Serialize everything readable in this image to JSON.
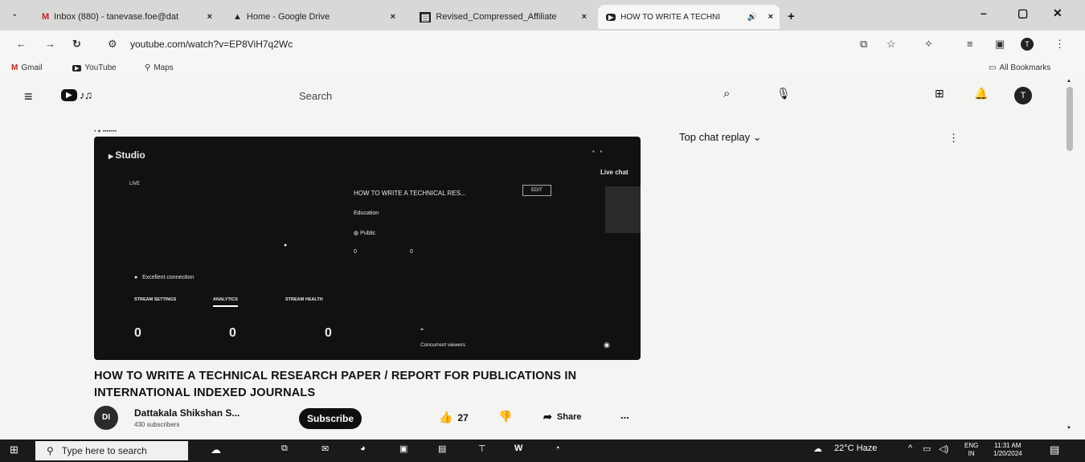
{
  "browser": {
    "tabs": [
      {
        "label": "Inbox (880) - tanevase.foe@dat",
        "icon": "gmail-icon"
      },
      {
        "label": "Home - Google Drive",
        "icon": "drive-icon"
      },
      {
        "label": "Revised_Compressed_Affiliate",
        "icon": "doc-icon"
      },
      {
        "label": "HOW TO WRITE A TECHNI",
        "icon": "youtube-icon"
      }
    ],
    "new_tab": "+",
    "url": "youtube.com/watch?v=EP8ViH7q2Wc",
    "bookmarks": [
      "Gmail",
      "YouTube",
      "Maps"
    ],
    "all_bookmarks": "All Bookmarks"
  },
  "youtube": {
    "search_placeholder": "Search",
    "chat_header": "Top chat replay"
  },
  "studio": {
    "brand": "Studio",
    "live_label": "LIVE",
    "live_chat": "Live chat",
    "video_title": "HOW TO WRITE A TECHNICAL RES...",
    "edit_btn": "EDIT",
    "category": "Education",
    "visibility": "Public",
    "stat_a": "0",
    "stat_b": "0",
    "connection": "Excellent connection",
    "tabs": [
      "STREAM SETTINGS",
      "ANALYTICS",
      "STREAM HEALTH"
    ],
    "counters": [
      "0",
      "0",
      "0",
      "-"
    ],
    "concurrent": "Concurrent viewers"
  },
  "video": {
    "title": "HOW TO WRITE A TECHNICAL RESEARCH PAPER / REPORT FOR PUBLICATIONS IN INTERNATIONAL INDEXED JOURNALS",
    "channel_name": "Dattakala Shikshan S...",
    "subscribers": "430 subscribers",
    "subscribe": "Subscribe",
    "likes": "27",
    "share": "Share",
    "more": "..."
  },
  "taskbar": {
    "search_placeholder": "Type here to search",
    "weather": "22°C Haze",
    "lang_top": "ENG",
    "lang_bottom": "IN",
    "time": "11:31 AM",
    "date": "1/20/2024"
  },
  "colors": {
    "youtube_red": "#e62117",
    "dark": "#111111"
  }
}
